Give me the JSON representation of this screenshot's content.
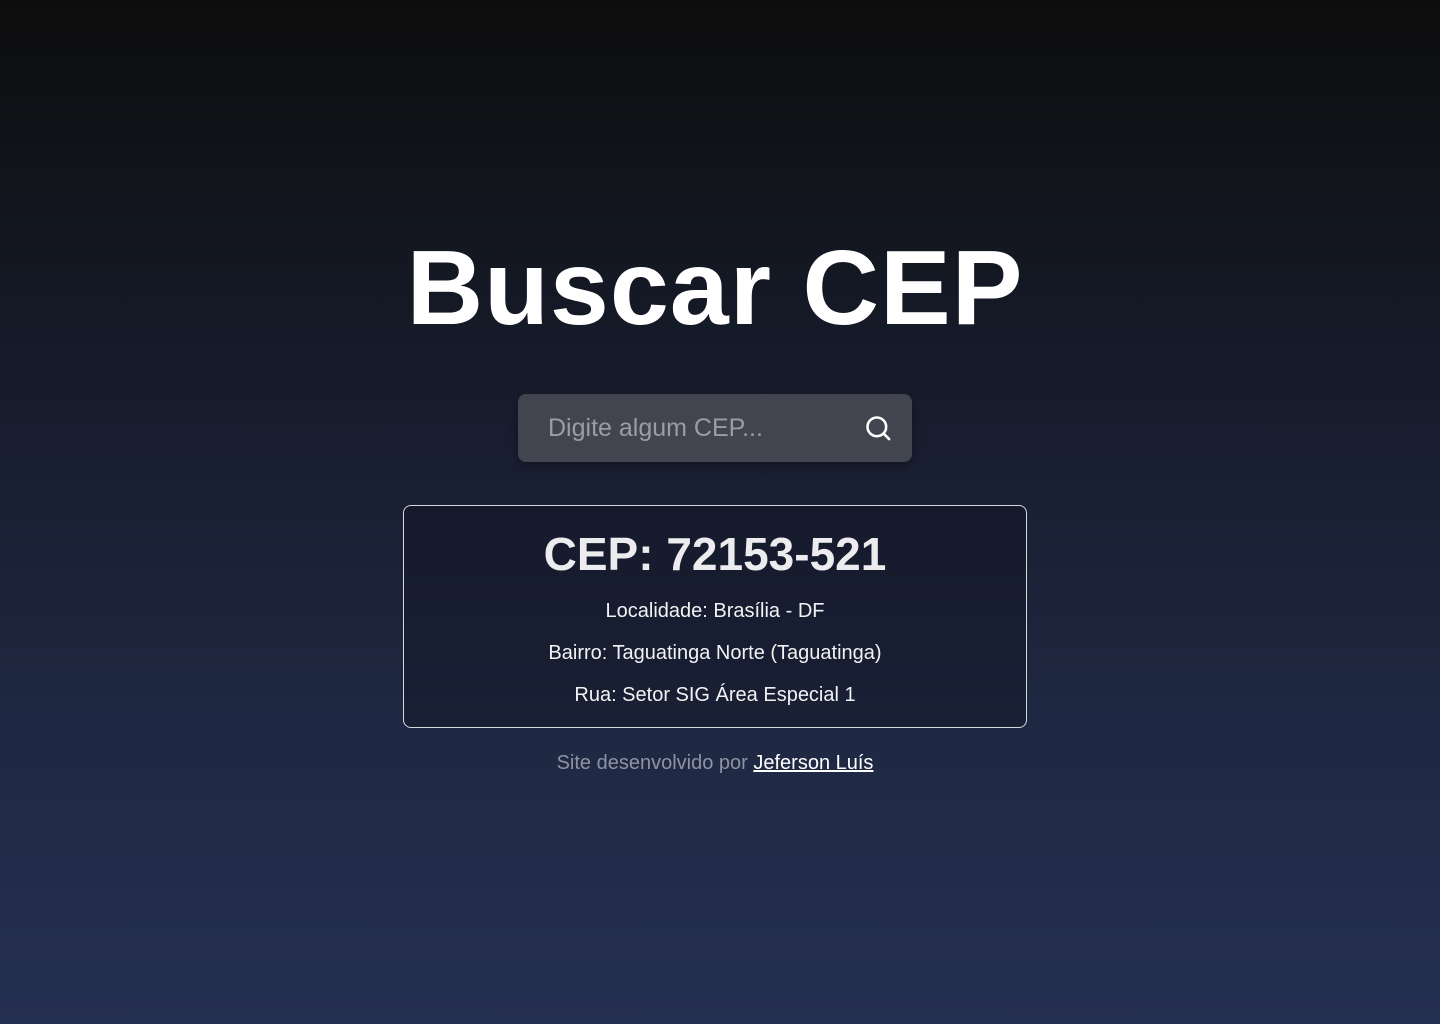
{
  "page": {
    "title": "Buscar CEP"
  },
  "search": {
    "placeholder": "Digite algum CEP...",
    "value": "",
    "button_icon": "search-icon"
  },
  "result": {
    "cep_label": "CEP: 72153-521",
    "localidade": "Localidade: Brasília - DF",
    "bairro": "Bairro: Taguatinga Norte (Taguatinga)",
    "rua": "Rua: Setor SIG Área Especial 1"
  },
  "footer": {
    "text": "Site desenvolvido por",
    "author_link": "Jeferson Luís"
  },
  "colors": {
    "background_top": "#0d0d0d",
    "background_bottom": "#252f51",
    "search_box": "#42444f",
    "text_primary": "#ffffff",
    "footer_text": "#8e93a3"
  }
}
